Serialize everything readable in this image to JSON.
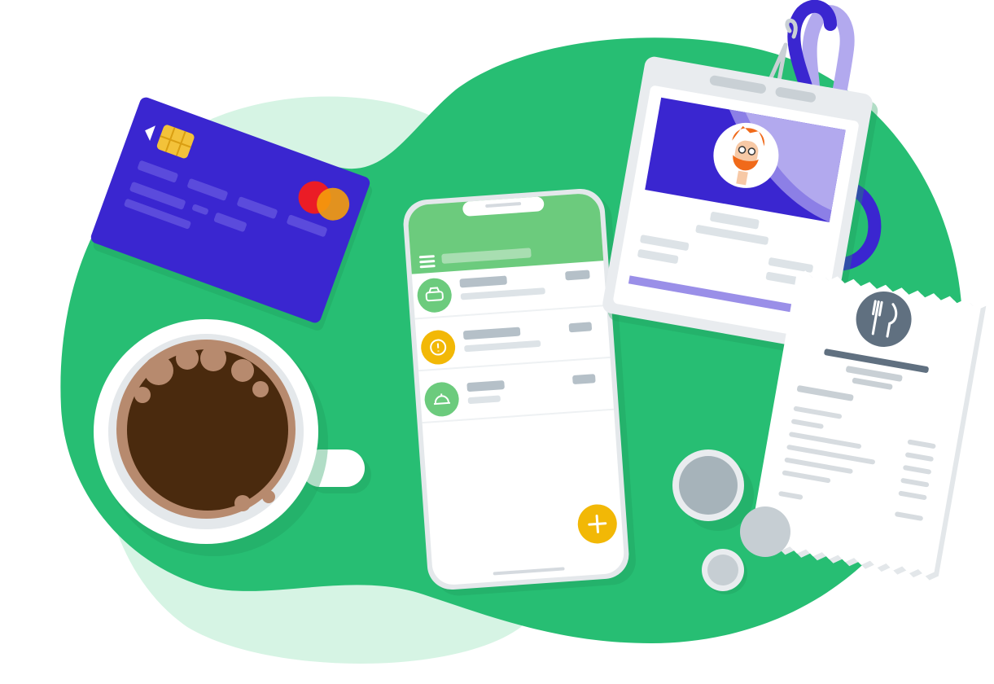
{
  "colors": {
    "blob_green": "#27BE73",
    "blob_light": "#D6F4E4",
    "card_blue": "#3A26D0",
    "chip_gold": "#F3C23A",
    "mc_red": "#EB1C26",
    "mc_orange": "#F59E0B",
    "coffee": "#4A2A0E",
    "crema": "#B78A6E",
    "phone_header": "#6CCB7D",
    "accent_yellow": "#F2B806",
    "badge_purple": "#3A26D0",
    "badge_lilac": "#B2A9EE",
    "receipt_icon": "#607080",
    "coin_grey": "#A6B3BA"
  },
  "icons": {
    "card_contactless": "chevron-left-icon",
    "phone_menu": "hamburger-menu-icon",
    "row_1": "taxi-icon",
    "row_2": "alert-exclamation-icon",
    "row_3": "food-cloche-icon",
    "fab": "plus-icon",
    "receipt": "fork-knife-icon",
    "badge_avatar": "bearded-person-avatar"
  },
  "phone": {
    "rows": [
      {
        "icon": "taxi-icon",
        "color": "#6CCB7D"
      },
      {
        "icon": "alert-exclamation-icon",
        "color": "#F2B806"
      },
      {
        "icon": "food-cloche-icon",
        "color": "#6CCB7D"
      }
    ]
  }
}
